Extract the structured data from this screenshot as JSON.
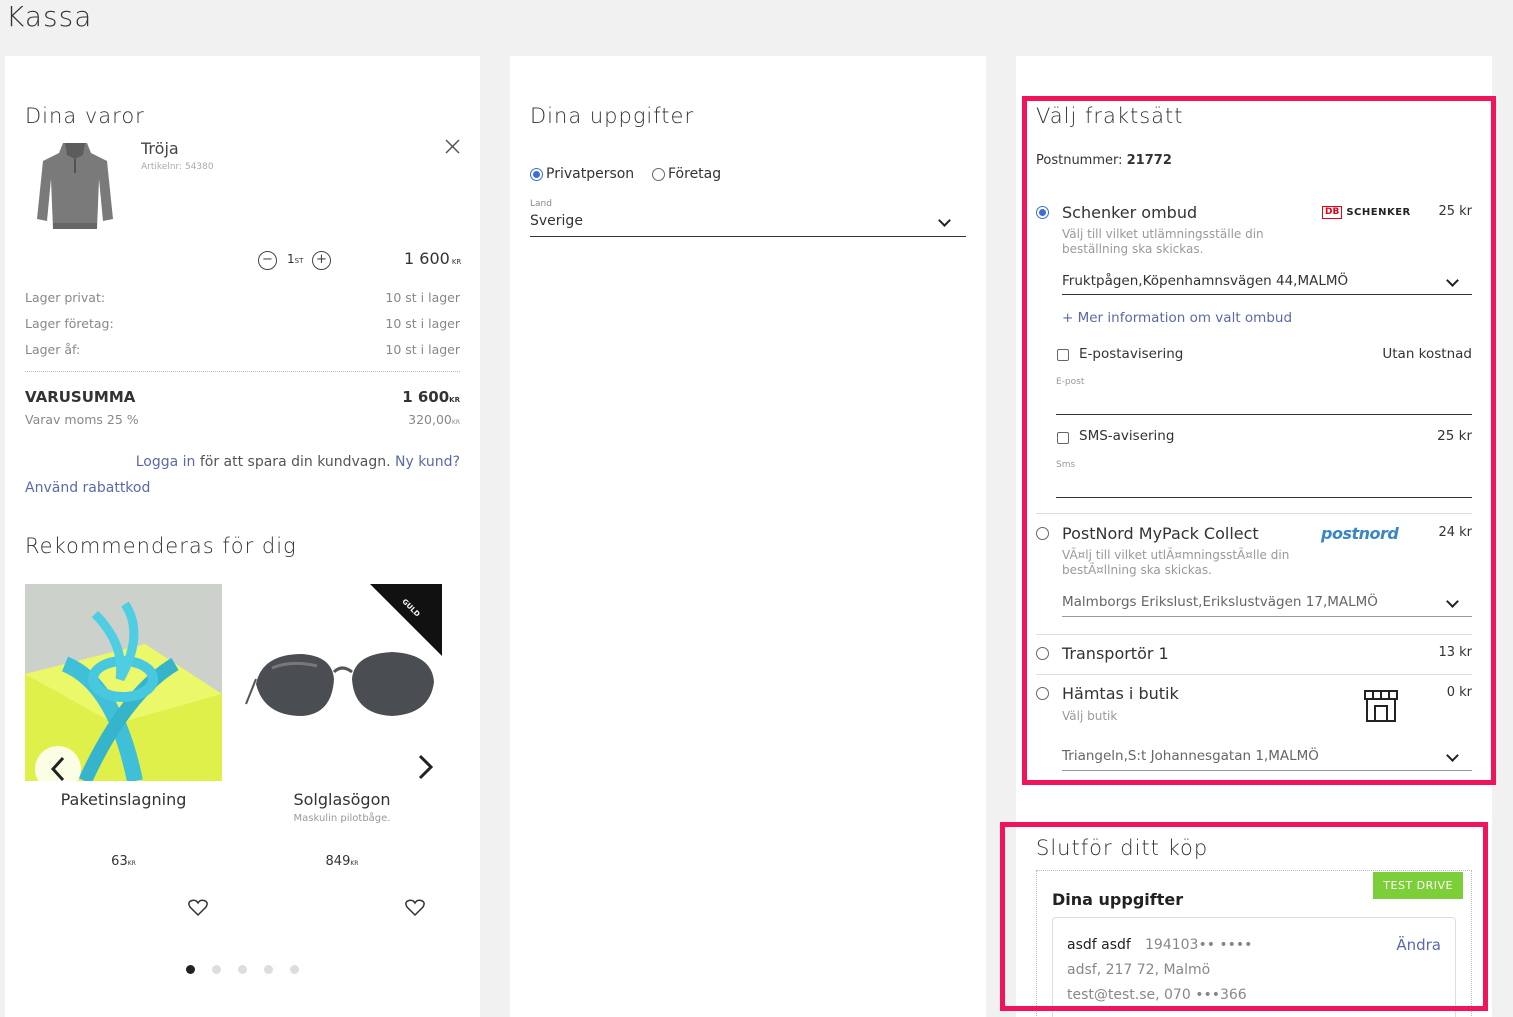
{
  "page": {
    "title": "Kassa"
  },
  "cart": {
    "heading": "Dina varor",
    "item": {
      "name": "Tröja",
      "article": "Artikelnr: 54380",
      "qty": "1",
      "qty_unit": "ST",
      "price": "1 600",
      "price_unit": "KR"
    },
    "stock": [
      {
        "label": "Lager privat:",
        "value": "10 st i lager"
      },
      {
        "label": "Lager företag:",
        "value": "10 st i lager"
      },
      {
        "label": "Lager åf:",
        "value": "10 st i lager"
      }
    ],
    "sum_label": "VARUSUMMA",
    "sum_value": "1 600",
    "sum_unit": "KR",
    "vat_label": "Varav moms 25 %",
    "vat_value": "320,00",
    "vat_unit": "KR",
    "login_link": "Logga in",
    "login_text": "för att spara din kundvagn.",
    "new_customer_link": "Ny kund?",
    "discount_link": "Använd rabattkod"
  },
  "recommend": {
    "heading": "Rekommenderas för dig",
    "products": [
      {
        "name": "Paketinslagning",
        "desc": "",
        "price": "63",
        "unit": "KR"
      },
      {
        "name": "Solglasögon",
        "desc": "Maskulin pilotbåge.",
        "price": "849",
        "unit": "KR",
        "badge": "GULD"
      }
    ]
  },
  "details": {
    "heading": "Dina uppgifter",
    "type_options": [
      "Privatperson",
      "Företag"
    ],
    "country_label": "Land",
    "country_value": "Sverige"
  },
  "shipping": {
    "heading": "Välj fraktsätt",
    "postal_label": "Postnummer:",
    "postal_value": "21772",
    "options": [
      {
        "name": "Schenker ombud",
        "desc": "Välj till vilket utlämningsställe din beställning ska skickas.",
        "price": "25 kr",
        "logo": "DB SCHENKER",
        "location": "Fruktpågen,Köpenhamnsvägen 44,MALMÖ",
        "info_link": "+ Mer information om valt ombud",
        "email_label": "E-postavisering",
        "email_price": "Utan kostnad",
        "email_field_label": "E-post",
        "sms_label": "SMS-avisering",
        "sms_price": "25 kr",
        "sms_field_label": "Sms"
      },
      {
        "name": "PostNord MyPack Collect",
        "desc": "VÃ¤lj till vilket utlÃ¤mningsstÃ¤lle din bestÃ¤llning ska skickas.",
        "price": "24 kr",
        "logo": "postnord",
        "location": "Malmborgs Erikslust,Erikslustvägen 17,MALMÖ"
      },
      {
        "name": "Transportör 1",
        "price": "13 kr"
      },
      {
        "name": "Hämtas i butik",
        "desc": "Välj butik",
        "price": "0 kr",
        "location": "Triangeln,S:t Johannesgatan 1,MALMÖ"
      }
    ]
  },
  "checkout": {
    "heading": "Slutför ditt köp",
    "badge": "TEST DRIVE",
    "subheading": "Dina uppgifter",
    "name": "asdf asdf",
    "pnr": "194103•• ••••",
    "address": "adsf, 217 72, Malmö",
    "contact": "test@test.se, 070 •••366",
    "change": "Ändra"
  },
  "colors": {
    "highlight": "#f0145a",
    "link": "#5a6aa8",
    "radio": "#3a6fd8",
    "badge": "#7dcf3a"
  }
}
